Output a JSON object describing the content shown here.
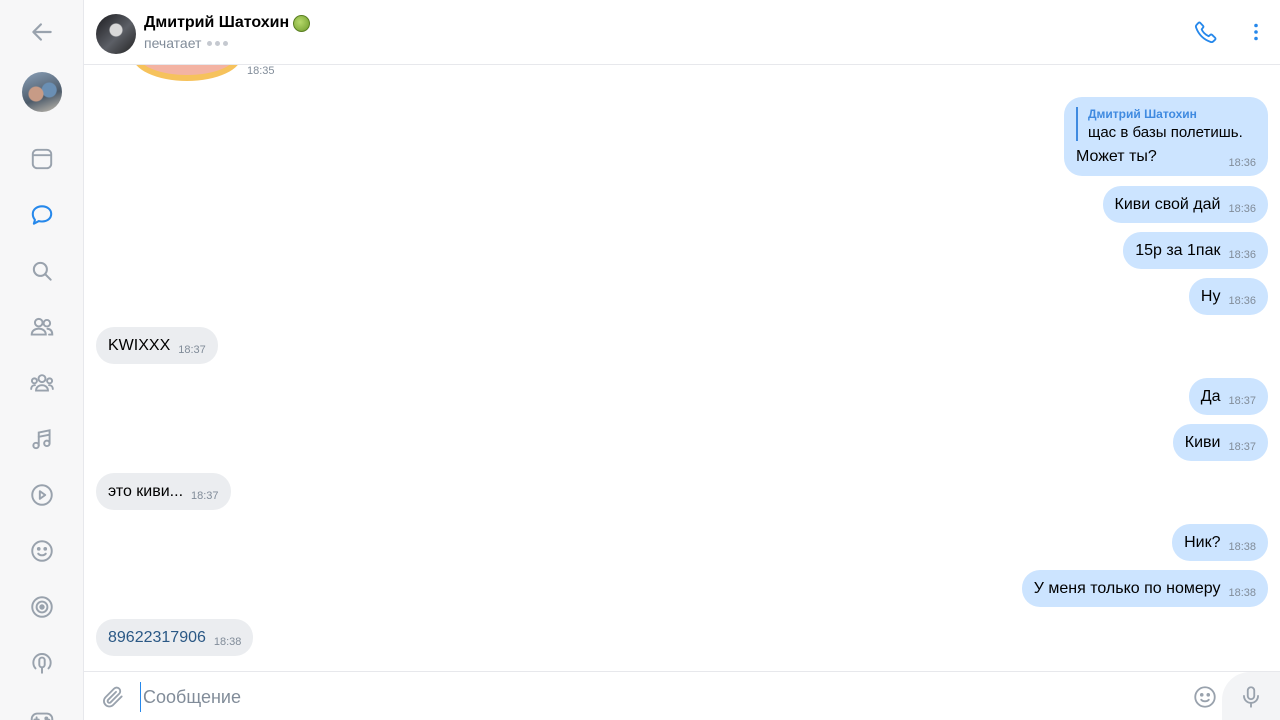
{
  "sidebar": {
    "items": [
      {
        "name": "back-arrow-icon"
      },
      {
        "name": "profile-avatar"
      },
      {
        "name": "news-icon"
      },
      {
        "name": "messages-icon",
        "active": true
      },
      {
        "name": "search-icon"
      },
      {
        "name": "friends-icon"
      },
      {
        "name": "communities-icon"
      },
      {
        "name": "music-icon"
      },
      {
        "name": "video-icon"
      },
      {
        "name": "emoji-icon"
      },
      {
        "name": "target-icon"
      },
      {
        "name": "podcast-icon"
      },
      {
        "name": "games-icon"
      }
    ],
    "active_color": "#2688eb",
    "icon_color": "#99a2ad"
  },
  "header": {
    "contact_name": "Дмитрий Шатохин",
    "status": "печатает",
    "accent": "#2688eb"
  },
  "chat": {
    "sticker_time": "18:35",
    "reply_message": {
      "reply_author": "Дмитрий Шатохин",
      "reply_text": "щас в базы полетишь.",
      "text": "Может ты?",
      "time": "18:36"
    },
    "messages": [
      {
        "dir": "out",
        "text": "Киви свой дай",
        "time": "18:36"
      },
      {
        "dir": "out",
        "text": "15р за 1пак",
        "time": "18:36"
      },
      {
        "dir": "out",
        "text": "Ну",
        "time": "18:36"
      },
      {
        "dir": "in",
        "text": "KWIXXX",
        "time": "18:37"
      },
      {
        "dir": "out",
        "text": "Да",
        "time": "18:37"
      },
      {
        "dir": "out",
        "text": "Киви",
        "time": "18:37"
      },
      {
        "dir": "in",
        "text": "это киви...",
        "time": "18:37"
      },
      {
        "dir": "out",
        "text": "Ник?",
        "time": "18:38"
      },
      {
        "dir": "out",
        "text": "У меня только по номеру",
        "time": "18:38"
      },
      {
        "dir": "in",
        "text": "89622317906",
        "time": "18:38",
        "link": true
      }
    ],
    "outgoing_color": "#cce4ff",
    "incoming_color": "#ebedf0"
  },
  "composer": {
    "placeholder": "Сообщение",
    "value": ""
  }
}
